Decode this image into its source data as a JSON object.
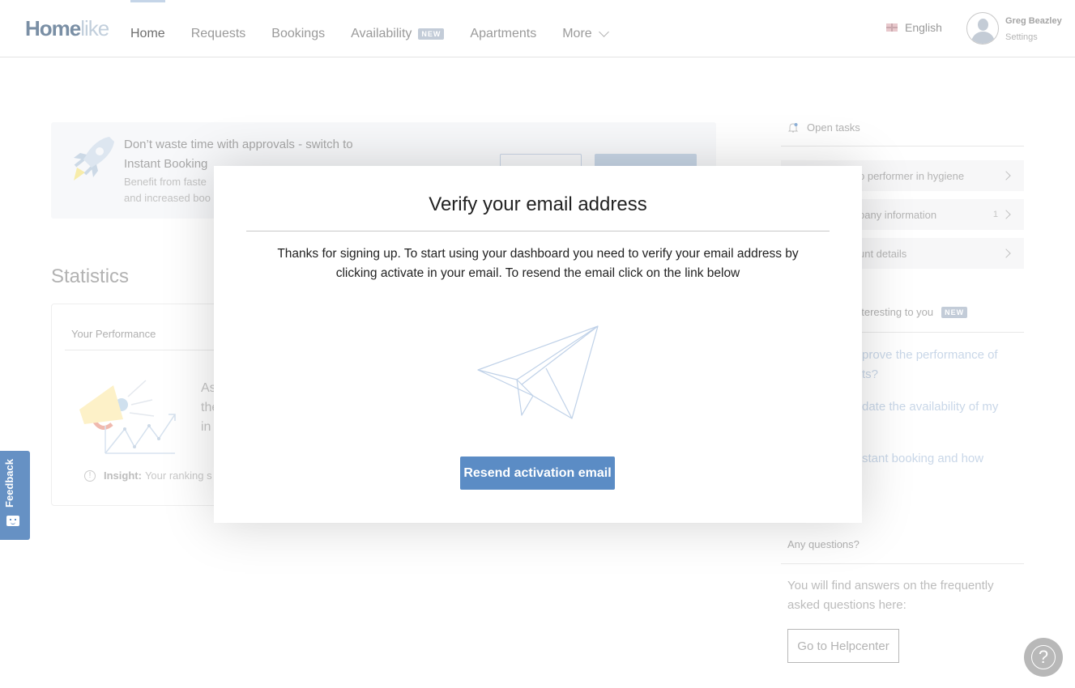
{
  "header": {
    "logo_bold": "Home",
    "logo_light": "like",
    "nav": [
      {
        "label": "Home",
        "active": true
      },
      {
        "label": "Requests"
      },
      {
        "label": "Bookings"
      },
      {
        "label": "Availability",
        "badge": "NEW"
      },
      {
        "label": "Apartments"
      },
      {
        "label": "More",
        "icon": "chevron-down-icon"
      }
    ],
    "language": "English",
    "user": {
      "name": "Greg Beazley",
      "settings_label": "Settings"
    }
  },
  "promo": {
    "title": "Don’t waste time with approvals - switch to Instant Booking",
    "subtitle_visible": "Benefit from faste\nand increased boo"
  },
  "statistics": {
    "title": "Statistics",
    "card_title": "Your Performance",
    "text_visible": [
      "As",
      "the",
      "in"
    ],
    "insight_label": "Insight:",
    "insight_text": "Your ranking s"
  },
  "sidebar": {
    "open_tasks_label": "Open tasks",
    "tasks": [
      {
        "label": "p performer in hygiene",
        "count": ""
      },
      {
        "label": "pany information",
        "count": "1"
      },
      {
        "label": "unt details",
        "count": ""
      }
    ],
    "interesting_label": "nteresting to you",
    "interesting_badge": "NEW",
    "questions": [
      "prove the performance of\nts?",
      "date the availability of my",
      "stant booking and how"
    ],
    "any_questions_label": "Any questions?",
    "faq_text": "You will find answers on the frequently asked questions here:",
    "helpcenter_button": "Go to Helpcenter"
  },
  "feedback_tab": {
    "label": "Feedback"
  },
  "help_fab": {
    "symbol": "?"
  },
  "modal": {
    "title": "Verify your email address",
    "body": "Thanks for signing up. To start using your dashboard you need to verify your email address by clicking activate in your email. To resend the email click on the link below",
    "button": "Resend activation email",
    "accent_color": "#5b8cc5"
  }
}
